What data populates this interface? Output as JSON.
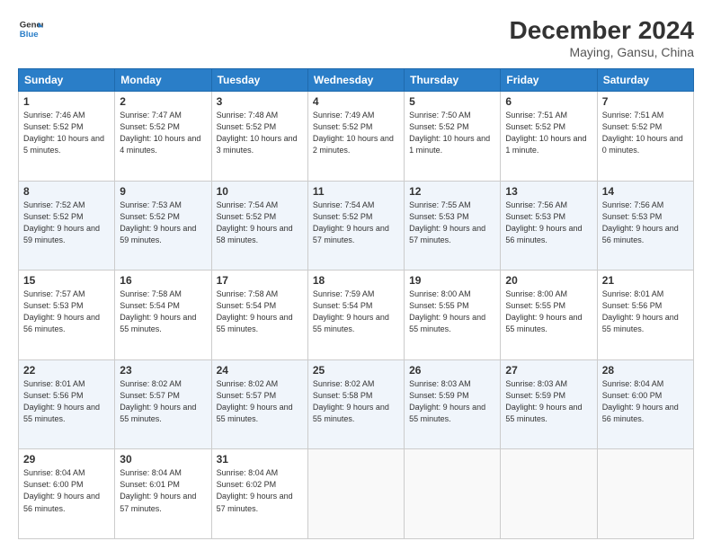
{
  "header": {
    "logo_line1": "General",
    "logo_line2": "Blue",
    "title": "December 2024",
    "subtitle": "Maying, Gansu, China"
  },
  "weekdays": [
    "Sunday",
    "Monday",
    "Tuesday",
    "Wednesday",
    "Thursday",
    "Friday",
    "Saturday"
  ],
  "weeks": [
    [
      {
        "day": "1",
        "sunrise": "Sunrise: 7:46 AM",
        "sunset": "Sunset: 5:52 PM",
        "daylight": "Daylight: 10 hours and 5 minutes."
      },
      {
        "day": "2",
        "sunrise": "Sunrise: 7:47 AM",
        "sunset": "Sunset: 5:52 PM",
        "daylight": "Daylight: 10 hours and 4 minutes."
      },
      {
        "day": "3",
        "sunrise": "Sunrise: 7:48 AM",
        "sunset": "Sunset: 5:52 PM",
        "daylight": "Daylight: 10 hours and 3 minutes."
      },
      {
        "day": "4",
        "sunrise": "Sunrise: 7:49 AM",
        "sunset": "Sunset: 5:52 PM",
        "daylight": "Daylight: 10 hours and 2 minutes."
      },
      {
        "day": "5",
        "sunrise": "Sunrise: 7:50 AM",
        "sunset": "Sunset: 5:52 PM",
        "daylight": "Daylight: 10 hours and 1 minute."
      },
      {
        "day": "6",
        "sunrise": "Sunrise: 7:51 AM",
        "sunset": "Sunset: 5:52 PM",
        "daylight": "Daylight: 10 hours and 1 minute."
      },
      {
        "day": "7",
        "sunrise": "Sunrise: 7:51 AM",
        "sunset": "Sunset: 5:52 PM",
        "daylight": "Daylight: 10 hours and 0 minutes."
      }
    ],
    [
      {
        "day": "8",
        "sunrise": "Sunrise: 7:52 AM",
        "sunset": "Sunset: 5:52 PM",
        "daylight": "Daylight: 9 hours and 59 minutes."
      },
      {
        "day": "9",
        "sunrise": "Sunrise: 7:53 AM",
        "sunset": "Sunset: 5:52 PM",
        "daylight": "Daylight: 9 hours and 59 minutes."
      },
      {
        "day": "10",
        "sunrise": "Sunrise: 7:54 AM",
        "sunset": "Sunset: 5:52 PM",
        "daylight": "Daylight: 9 hours and 58 minutes."
      },
      {
        "day": "11",
        "sunrise": "Sunrise: 7:54 AM",
        "sunset": "Sunset: 5:52 PM",
        "daylight": "Daylight: 9 hours and 57 minutes."
      },
      {
        "day": "12",
        "sunrise": "Sunrise: 7:55 AM",
        "sunset": "Sunset: 5:53 PM",
        "daylight": "Daylight: 9 hours and 57 minutes."
      },
      {
        "day": "13",
        "sunrise": "Sunrise: 7:56 AM",
        "sunset": "Sunset: 5:53 PM",
        "daylight": "Daylight: 9 hours and 56 minutes."
      },
      {
        "day": "14",
        "sunrise": "Sunrise: 7:56 AM",
        "sunset": "Sunset: 5:53 PM",
        "daylight": "Daylight: 9 hours and 56 minutes."
      }
    ],
    [
      {
        "day": "15",
        "sunrise": "Sunrise: 7:57 AM",
        "sunset": "Sunset: 5:53 PM",
        "daylight": "Daylight: 9 hours and 56 minutes."
      },
      {
        "day": "16",
        "sunrise": "Sunrise: 7:58 AM",
        "sunset": "Sunset: 5:54 PM",
        "daylight": "Daylight: 9 hours and 55 minutes."
      },
      {
        "day": "17",
        "sunrise": "Sunrise: 7:58 AM",
        "sunset": "Sunset: 5:54 PM",
        "daylight": "Daylight: 9 hours and 55 minutes."
      },
      {
        "day": "18",
        "sunrise": "Sunrise: 7:59 AM",
        "sunset": "Sunset: 5:54 PM",
        "daylight": "Daylight: 9 hours and 55 minutes."
      },
      {
        "day": "19",
        "sunrise": "Sunrise: 8:00 AM",
        "sunset": "Sunset: 5:55 PM",
        "daylight": "Daylight: 9 hours and 55 minutes."
      },
      {
        "day": "20",
        "sunrise": "Sunrise: 8:00 AM",
        "sunset": "Sunset: 5:55 PM",
        "daylight": "Daylight: 9 hours and 55 minutes."
      },
      {
        "day": "21",
        "sunrise": "Sunrise: 8:01 AM",
        "sunset": "Sunset: 5:56 PM",
        "daylight": "Daylight: 9 hours and 55 minutes."
      }
    ],
    [
      {
        "day": "22",
        "sunrise": "Sunrise: 8:01 AM",
        "sunset": "Sunset: 5:56 PM",
        "daylight": "Daylight: 9 hours and 55 minutes."
      },
      {
        "day": "23",
        "sunrise": "Sunrise: 8:02 AM",
        "sunset": "Sunset: 5:57 PM",
        "daylight": "Daylight: 9 hours and 55 minutes."
      },
      {
        "day": "24",
        "sunrise": "Sunrise: 8:02 AM",
        "sunset": "Sunset: 5:57 PM",
        "daylight": "Daylight: 9 hours and 55 minutes."
      },
      {
        "day": "25",
        "sunrise": "Sunrise: 8:02 AM",
        "sunset": "Sunset: 5:58 PM",
        "daylight": "Daylight: 9 hours and 55 minutes."
      },
      {
        "day": "26",
        "sunrise": "Sunrise: 8:03 AM",
        "sunset": "Sunset: 5:59 PM",
        "daylight": "Daylight: 9 hours and 55 minutes."
      },
      {
        "day": "27",
        "sunrise": "Sunrise: 8:03 AM",
        "sunset": "Sunset: 5:59 PM",
        "daylight": "Daylight: 9 hours and 55 minutes."
      },
      {
        "day": "28",
        "sunrise": "Sunrise: 8:04 AM",
        "sunset": "Sunset: 6:00 PM",
        "daylight": "Daylight: 9 hours and 56 minutes."
      }
    ],
    [
      {
        "day": "29",
        "sunrise": "Sunrise: 8:04 AM",
        "sunset": "Sunset: 6:00 PM",
        "daylight": "Daylight: 9 hours and 56 minutes."
      },
      {
        "day": "30",
        "sunrise": "Sunrise: 8:04 AM",
        "sunset": "Sunset: 6:01 PM",
        "daylight": "Daylight: 9 hours and 57 minutes."
      },
      {
        "day": "31",
        "sunrise": "Sunrise: 8:04 AM",
        "sunset": "Sunset: 6:02 PM",
        "daylight": "Daylight: 9 hours and 57 minutes."
      },
      null,
      null,
      null,
      null
    ]
  ]
}
